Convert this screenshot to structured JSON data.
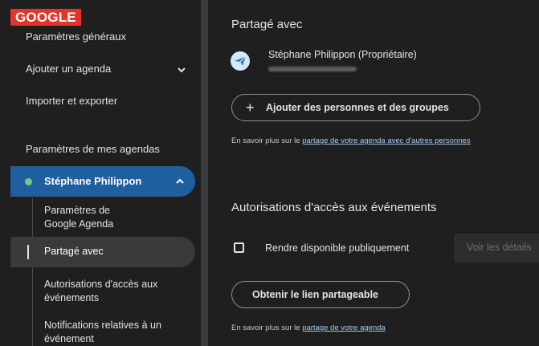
{
  "badge": "GOOGLE",
  "sidebar": {
    "general_settings": "Paramètres généraux",
    "add_calendar": "Ajouter un agenda",
    "import_export": "Importer et exporter",
    "my_calendars_heading": "Paramètres de mes agendas",
    "calendar_name": "Stéphane Philippon",
    "calendar_color": "#7cc47f",
    "sub_items": [
      {
        "line1": "Paramètres de",
        "line2": "Google Agenda"
      },
      {
        "line1": "Partagé avec"
      },
      {
        "line1": "Autorisations d'accès aux",
        "line2": "événements"
      },
      {
        "line1": "Notifications relatives à un",
        "line2": "événement"
      }
    ]
  },
  "main": {
    "shared_heading": "Partagé avec",
    "owner_name": "Stéphane Philippon (Propriétaire)",
    "add_people_icon": "+",
    "add_people_label": "Ajouter des personnes et des groupes",
    "share_note_prefix": "En savoir plus sur le ",
    "share_note_link": "partage de votre agenda avec d'autres personnes",
    "permissions_heading": "Autorisations d'accès aux événements",
    "public_checkbox_label": "Rendre disponible publiquement",
    "public_checkbox_checked": false,
    "view_details_label": "Voir les détails",
    "get_link_label": "Obtenir le lien partageable",
    "link_note_prefix": "En savoir plus sur le ",
    "link_note_link": "partage de votre agenda"
  }
}
